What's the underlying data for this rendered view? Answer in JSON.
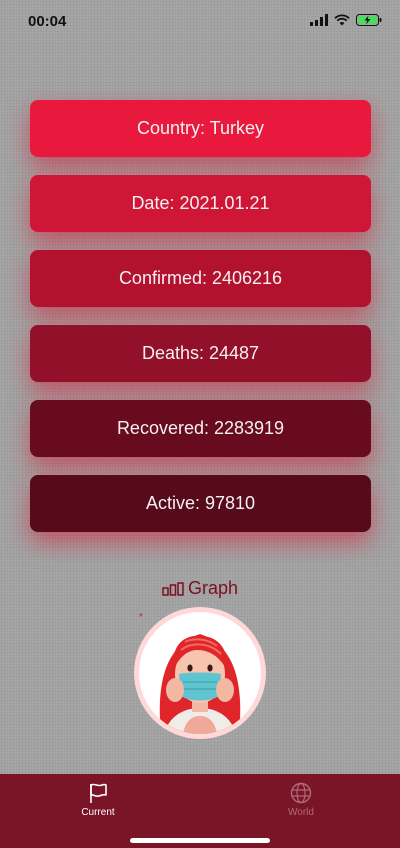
{
  "status_bar": {
    "time": "00:04"
  },
  "cards": [
    {
      "label": "Country: Turkey"
    },
    {
      "label": "Date: 2021.01.21"
    },
    {
      "label": "Confirmed: 2406216"
    },
    {
      "label": "Deaths: 24487"
    },
    {
      "label": "Recovered: 2283919"
    },
    {
      "label": "Active: 97810"
    }
  ],
  "graph_button": {
    "label": "Graph",
    "icon": "bar-chart-icon"
  },
  "avatar": {
    "icon": "masked-woman-illustration"
  },
  "tabs": [
    {
      "label": "Current",
      "icon": "flag-icon",
      "active": true
    },
    {
      "label": "World",
      "icon": "globe-icon",
      "active": false
    }
  ],
  "colors": {
    "card_1": "#e8193d",
    "card_2": "#cf1636",
    "card_3": "#b3122f",
    "card_4": "#921029",
    "card_5": "#680b1e",
    "card_6": "#560a1a",
    "tab_bar": "#7a1527",
    "graph_text": "#7a1024"
  }
}
